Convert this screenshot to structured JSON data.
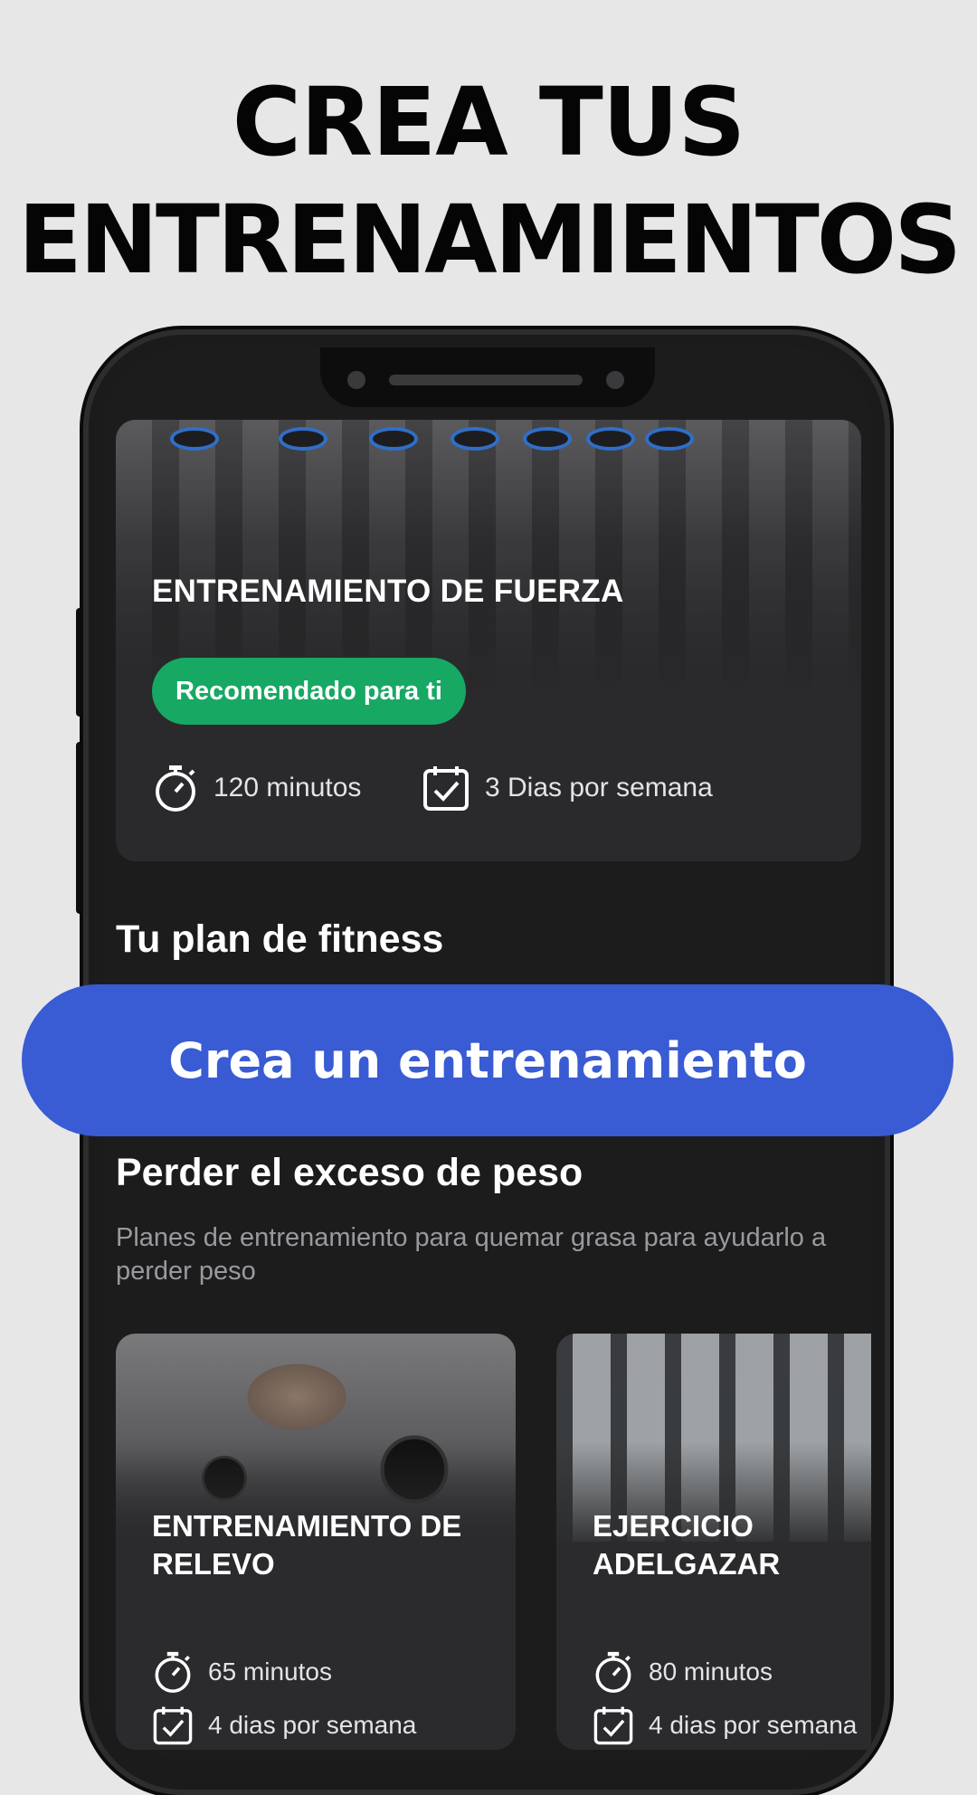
{
  "headline": {
    "line1": "CREA TUS",
    "line2": "ENTRENAMIENTOS"
  },
  "featured": {
    "title": "ENTRENAMIENTO DE FUERZA",
    "badge": "Recomendado para ti",
    "duration": "120 minutos",
    "frequency": "3 Dias por semana",
    "icons": [
      "stopwatch-icon",
      "calendar-check-icon"
    ]
  },
  "plan_section": {
    "title": "Tu plan de fitness"
  },
  "cta": {
    "label": "Crea un entrenamiento",
    "color": "#395bd3"
  },
  "weight_section": {
    "title": "Perder el exceso de peso",
    "description": "Planes de entrenamiento para quemar grasa para ayudarlo a perder peso"
  },
  "cards": [
    {
      "title": "ENTRENAMIENTO DE RELEVO",
      "duration": "65 minutos",
      "frequency": "4 dias por semana"
    },
    {
      "title": "EJERCICIO ADELGAZAR",
      "duration": "80 minutos",
      "frequency": "4 dias por semana"
    }
  ],
  "colors": {
    "background": "#e7e7e8",
    "screen": "#1c1c1d",
    "badge_green": "#17a864",
    "card": "#2a2a2c"
  }
}
